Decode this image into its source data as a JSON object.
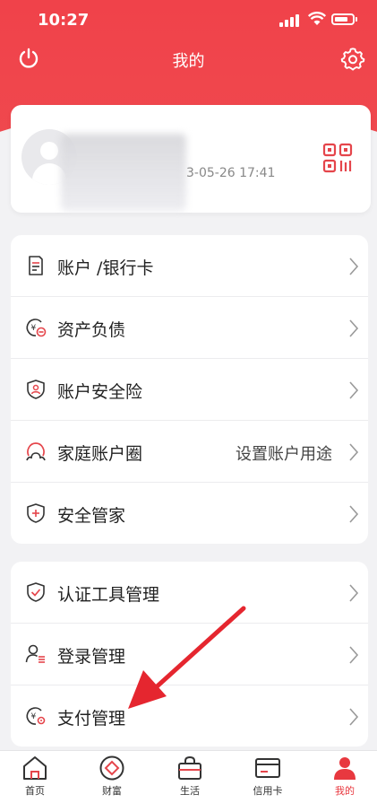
{
  "status_bar": {
    "time": "10:27"
  },
  "nav": {
    "title": "我的"
  },
  "profile": {
    "login_time": "3-05-26 17:41"
  },
  "menu_group1": [
    {
      "label": "账户 /银行卡",
      "icon": "account-card-icon"
    },
    {
      "label": "资产负债",
      "icon": "asset-liability-icon"
    },
    {
      "label": "账户安全险",
      "icon": "account-insurance-icon"
    },
    {
      "label": "家庭账户圈",
      "extra": "设置账户用途",
      "icon": "family-circle-icon"
    },
    {
      "label": "安全管家",
      "icon": "security-shield-icon"
    }
  ],
  "menu_group2": [
    {
      "label": "认证工具管理",
      "icon": "auth-tool-icon"
    },
    {
      "label": "登录管理",
      "icon": "login-manage-icon"
    },
    {
      "label": "支付管理",
      "icon": "payment-manage-icon"
    }
  ],
  "tabbar": [
    {
      "label": "首页",
      "icon": "home-icon"
    },
    {
      "label": "财富",
      "icon": "wealth-icon"
    },
    {
      "label": "生活",
      "icon": "life-bag-icon"
    },
    {
      "label": "信用卡",
      "icon": "credit-card-icon"
    },
    {
      "label": "我的",
      "icon": "me-icon",
      "active": true
    }
  ],
  "colors": {
    "brand": "#ef4a4f",
    "active_tab": "#e8383f",
    "annotation_arrow": "#e5262f"
  }
}
